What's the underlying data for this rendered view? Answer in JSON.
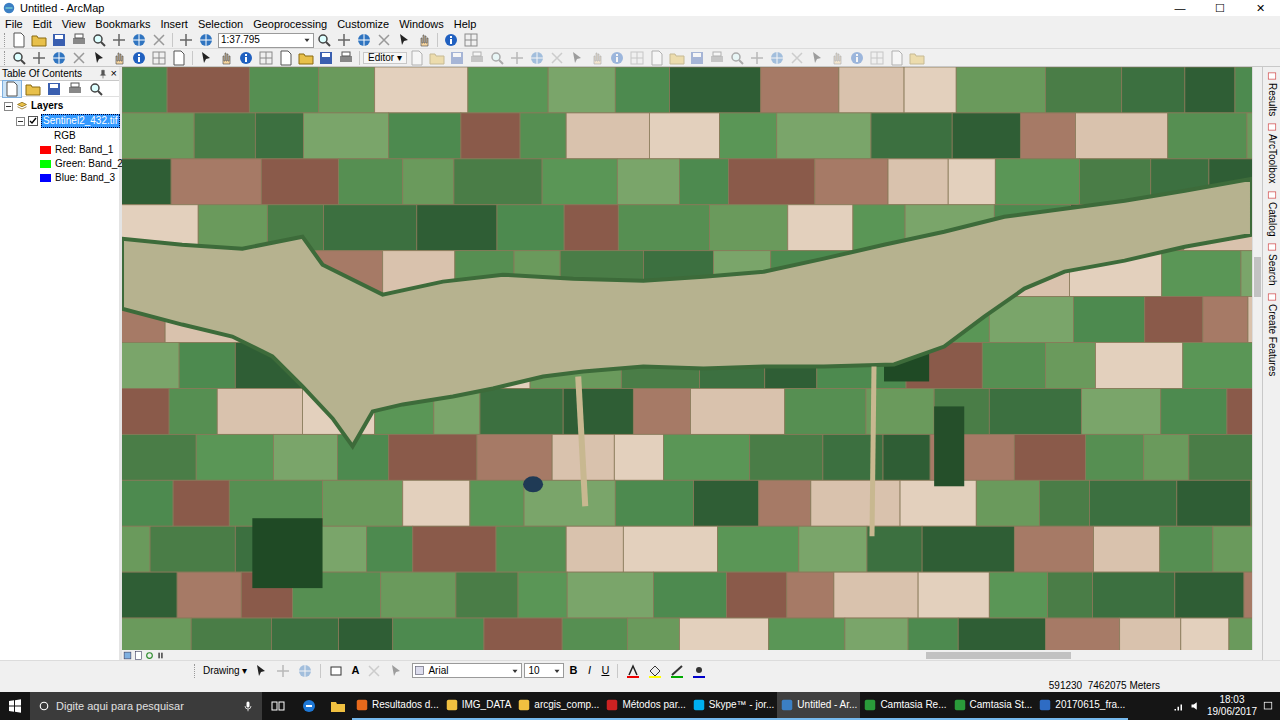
{
  "window": {
    "title": "Untitled - ArcMap",
    "buttons": [
      "—",
      "☐",
      "✕"
    ]
  },
  "menu": [
    "File",
    "Edit",
    "View",
    "Bookmarks",
    "Insert",
    "Selection",
    "Geoprocessing",
    "Customize",
    "Windows",
    "Help"
  ],
  "toolbar": {
    "scale": "1:37.795",
    "editor": "Editor ▾"
  },
  "toc": {
    "title": "Table Of Contents",
    "close": "×",
    "layers": {
      "label": "Layers",
      "expanded": true
    },
    "layer": {
      "label": "Sentinel2_432.tif",
      "expanded": true,
      "checked": true,
      "selected": true
    },
    "renderer": "RGB",
    "bands": [
      {
        "label": "Red: Band_1",
        "color": "#ff0000"
      },
      {
        "label": "Green: Band_2",
        "color": "#00ff00"
      },
      {
        "label": "Blue: Band_3",
        "color": "#0000ff"
      }
    ]
  },
  "dock_tabs": [
    "Results",
    "ArcToolbox",
    "Catalog",
    "Search",
    "Create Features"
  ],
  "drawing": {
    "label": "Drawing ▾",
    "font": "Arial",
    "size": "10",
    "styles": [
      "B",
      "I",
      "U"
    ],
    "font_color": "A"
  },
  "status": {
    "coordinates": "591230  7462075 Meters"
  },
  "taskbar": {
    "search": "Digite aqui para pesquisar",
    "apps": [
      {
        "label": "Resultados d...",
        "selected": false
      },
      {
        "label": "IMG_DATA",
        "selected": false
      },
      {
        "label": "arcgis_comp...",
        "selected": false
      },
      {
        "label": "Métodos par...",
        "selected": false
      },
      {
        "label": "Skype™ - jor...",
        "selected": false
      },
      {
        "label": "Untitled - Ar...",
        "selected": true
      },
      {
        "label": "Camtasia Re...",
        "selected": false
      },
      {
        "label": "Camtasia St...",
        "selected": false
      },
      {
        "label": "20170615_fra...",
        "selected": false
      }
    ],
    "time": "18:03",
    "date": "19/06/2017"
  }
}
